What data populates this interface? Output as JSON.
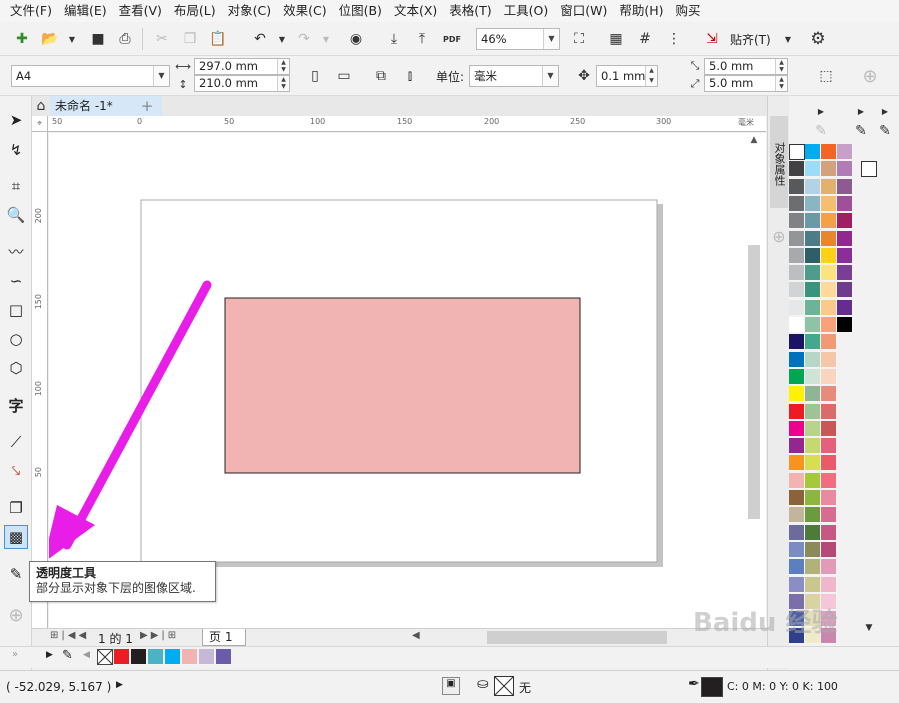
{
  "menu": [
    "文件(F)",
    "编辑(E)",
    "查看(V)",
    "布局(L)",
    "对象(C)",
    "效果(C)",
    "位图(B)",
    "文本(X)",
    "表格(T)",
    "工具(O)",
    "窗口(W)",
    "帮助(H)",
    "购买"
  ],
  "standard_toolbar": {
    "zoom": "46%",
    "snap_label": "贴齐(T)"
  },
  "property_bar": {
    "paper_size": "A4",
    "width": "297.0 mm",
    "height": "210.0 mm",
    "units_label": "单位:",
    "units_value": "毫米",
    "nudge": "0.1 mm",
    "dup_x": "5.0 mm",
    "dup_y": "5.0 mm"
  },
  "doc_tab": "未命名 -1*",
  "docker_title": "对象属性",
  "rulers": {
    "h": [
      "50",
      "0",
      "50",
      "100",
      "150",
      "200",
      "250",
      "300"
    ],
    "h_unit": "毫米",
    "v": [
      "200",
      "150",
      "100",
      "50"
    ]
  },
  "tooltip": {
    "title": "透明度工具",
    "body": "部分显示对象下层的图像区域."
  },
  "page_nav": {
    "counter": "1 的 1",
    "page_tab": "页 1"
  },
  "status": {
    "coords": "( -52.029, 5.167 )",
    "fill_none": "无",
    "outline": "C: 0 M: 0 Y: 0 K: 100"
  },
  "watermark": "Baidu 经验",
  "colors": {
    "accent_arrow": "#e81ee8",
    "rect_fill": "#f2b3b3",
    "rect_stroke": "#222222"
  },
  "palette_columns": [
    [
      "#231f20",
      "#414042",
      "#58595b",
      "#6d6e71",
      "#808285",
      "#939598",
      "#a7a9ac",
      "#bcbec0",
      "#d1d3d4",
      "#e6e7e8",
      "#ffffff",
      "#1b1464",
      "#0072bc",
      "#00a651",
      "#fff200",
      "#ed1c24",
      "#ec008c",
      "#92278f",
      "#f7941d",
      "#f2b3b3",
      "#8c6239",
      "#c2b59b",
      "#6d6b9b",
      "#7a8cc2",
      "#5b7fbf",
      "#8b8dc5",
      "#7b6ea9",
      "#4d5fa5",
      "#303f8c"
    ],
    [
      "#00aeef",
      "#9ddcf9",
      "#b4d2e6",
      "#8ab6c4",
      "#6c99a8",
      "#4b7c87",
      "#2f5e66",
      "#4f9c8c",
      "#38947c",
      "#6db39a",
      "#8fc3a6",
      "#44a88e",
      "#b6d7c7",
      "#d0e4d5",
      "#8fb596",
      "#a0c396",
      "#b8d48c",
      "#c5d96e",
      "#d6e04f",
      "#a6c93b",
      "#8db63c",
      "#6b9b3e",
      "#4c7b3b",
      "#8a8b58",
      "#b0b27a",
      "#c9c78e",
      "#d8d3a0",
      "#e5dfb6",
      "#efeac9"
    ],
    [
      "#f26522",
      "#d3a27b",
      "#e0b16f",
      "#f6be6e",
      "#f3a144",
      "#e8852f",
      "#fcd116",
      "#fde37e",
      "#ffd99a",
      "#fcc98c",
      "#f7a27b",
      "#f29a76",
      "#f5c6aa",
      "#f9d5c0",
      "#e78c7c",
      "#d96b6b",
      "#c95757",
      "#e4607b",
      "#ec5a6a",
      "#f06e80",
      "#e88aa0",
      "#d66c8f",
      "#c55983",
      "#b54a79",
      "#e29ab8",
      "#f0b6cc",
      "#f4c6d8",
      "#dfa0c0",
      "#c987ad"
    ],
    [
      "#c7a0c9",
      "#b17cb5",
      "#8d5b91",
      "#a04f99",
      "#9e1f63",
      "#92278f",
      "#8a2e9a",
      "#7a3f95",
      "#6f3b8c",
      "#662d91",
      "#000000"
    ]
  ],
  "bottom_palette": [
    "#ed1c24",
    "#231f20",
    "#4ab3c4",
    "#00aeef",
    "#f2b3b3",
    "#c8b8d8",
    "#6a5ca8"
  ]
}
